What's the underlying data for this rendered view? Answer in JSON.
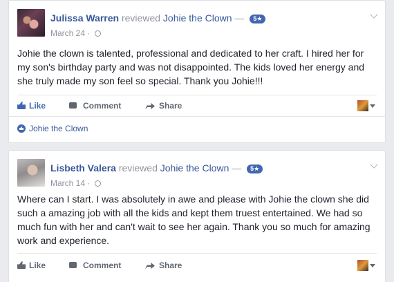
{
  "reviews": [
    {
      "author": "Julissa Warren",
      "verb": "reviewed",
      "page": "Johie the Clown",
      "dash": "—",
      "rating": "5★",
      "date": "March 24",
      "dot": "·",
      "text": "Johie the clown is talented, professional and dedicated to her craft. I hired her for my son's birthday party and was not disappointed. The kids loved her energy and she truly made my son feel so special. Thank you Johie!!!",
      "actions": {
        "like": "Like",
        "comment": "Comment",
        "share": "Share"
      },
      "liked_by": "Johie the Clown"
    },
    {
      "author": "Lisbeth Valera",
      "verb": "reviewed",
      "page": "Johie the Clown",
      "dash": "—",
      "rating": "5★",
      "date": "March 14",
      "dot": "·",
      "text": "Where can I start. I was absolutely in awe and please with Johie the clown she did such a amazing job with all the kids and kept them truest entertained. We had so much fun with her and can't wait to see her again. Thank you so much for amazing work and experience.",
      "actions": {
        "like": "Like",
        "comment": "Comment",
        "share": "Share"
      }
    }
  ],
  "colors": {
    "link": "#365899",
    "accent": "#4267b2",
    "muted": "#90949c",
    "background": "#e9ebee"
  },
  "icons": [
    "globe-icon",
    "chevron-down-icon",
    "like-icon",
    "comment-icon",
    "share-icon",
    "caret-down-icon"
  ]
}
